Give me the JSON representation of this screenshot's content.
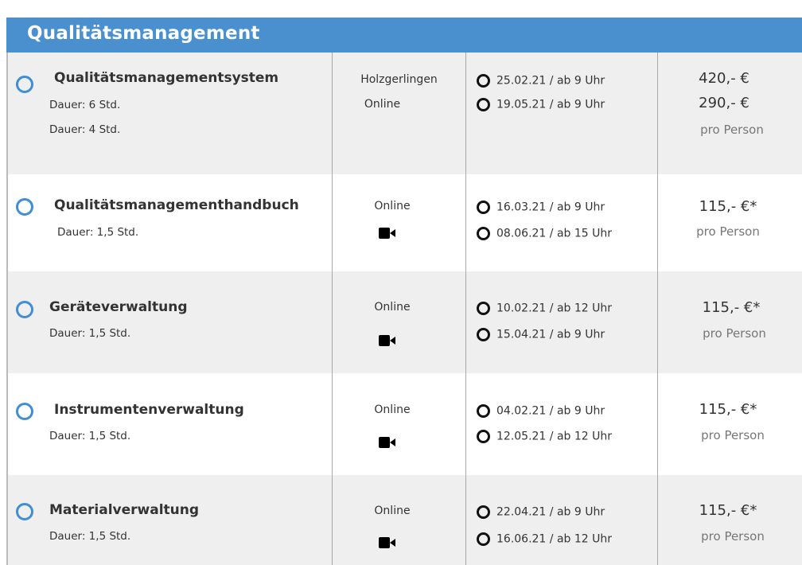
{
  "header": {
    "title": "Qualitätsmanagement"
  },
  "courses": [
    {
      "name": "Qualitätsmanagementsystem",
      "durations": [
        "Dauer: 6 Std.",
        "Dauer: 4 Std."
      ],
      "locations": [
        "Holzgerlingen",
        "Online"
      ],
      "dates": [
        "25.02.21 / ab 9 Uhr",
        "19.05.21 / ab 9 Uhr"
      ],
      "prices": [
        "420,- €",
        "290,- €"
      ],
      "per_person": "pro Person"
    },
    {
      "name": "Qualitätsmanagementhandbuch",
      "durations": [
        "Dauer: 1,5 Std."
      ],
      "locations": [
        "Online"
      ],
      "icon": "video-camera-icon",
      "dates": [
        "16.03.21 / ab 9 Uhr",
        "08.06.21 / ab 15 Uhr"
      ],
      "prices": [
        "115,- €*"
      ],
      "per_person": "pro Person"
    },
    {
      "name": "Geräteverwaltung",
      "durations": [
        "Dauer: 1,5 Std."
      ],
      "locations": [
        "Online"
      ],
      "icon": "video-camera-icon",
      "dates": [
        "10.02.21 / ab 12 Uhr",
        "15.04.21 / ab 9 Uhr"
      ],
      "prices": [
        "115,- €*"
      ],
      "per_person": "pro Person"
    },
    {
      "name": "Instrumentenverwaltung",
      "durations": [
        "Dauer: 1,5 Std."
      ],
      "locations": [
        "Online"
      ],
      "icon": "video-camera-icon",
      "dates": [
        "04.02.21 / ab 9 Uhr",
        "12.05.21 / ab 12 Uhr"
      ],
      "prices": [
        "115,- €*"
      ],
      "per_person": "pro Person"
    },
    {
      "name": "Materialverwaltung",
      "durations": [
        "Dauer: 1,5 Std."
      ],
      "locations": [
        "Online"
      ],
      "icon": "video-camera-icon",
      "dates": [
        "22.04.21 / ab 9 Uhr",
        "16.06.21 / ab 12 Uhr"
      ],
      "prices": [
        "115,- €*"
      ],
      "per_person": "pro Person"
    }
  ],
  "colors": {
    "header_bg": "#4a90cf",
    "radio_blue": "#3f8ed6",
    "row_shade": "#efefef"
  }
}
